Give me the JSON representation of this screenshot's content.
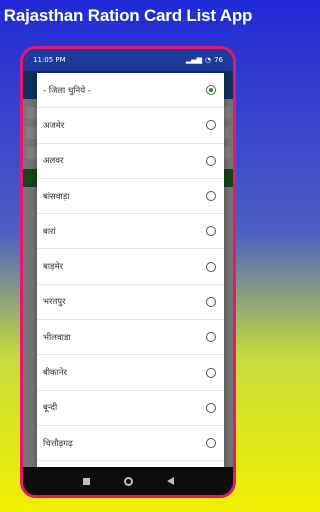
{
  "promo_title": "Rajasthan Ration Card List App",
  "statusbar": {
    "time": "11:05 PM",
    "battery": "76"
  },
  "dialog": {
    "options": [
      {
        "label": "- जिला चुनिये -",
        "selected": true
      },
      {
        "label": "अजमेर",
        "selected": false
      },
      {
        "label": "अलवर",
        "selected": false
      },
      {
        "label": "बांसवाड़ा",
        "selected": false
      },
      {
        "label": "बारां",
        "selected": false
      },
      {
        "label": "बाड़मेर",
        "selected": false
      },
      {
        "label": "भरतपुर",
        "selected": false
      },
      {
        "label": "भीलवाडा",
        "selected": false
      },
      {
        "label": "बीकानेर",
        "selected": false
      },
      {
        "label": "बून्दी",
        "selected": false
      },
      {
        "label": "चित्तौड़गढ़",
        "selected": false
      }
    ]
  },
  "colors": {
    "frame_border": "#e8166f",
    "radio_selected": "#2e7d32",
    "statusbar_bg": "#1c3a9c"
  },
  "icons": [
    "signal-icon",
    "wifi-icon",
    "battery-icon",
    "nav-recents-icon",
    "nav-home-icon",
    "nav-back-icon"
  ]
}
